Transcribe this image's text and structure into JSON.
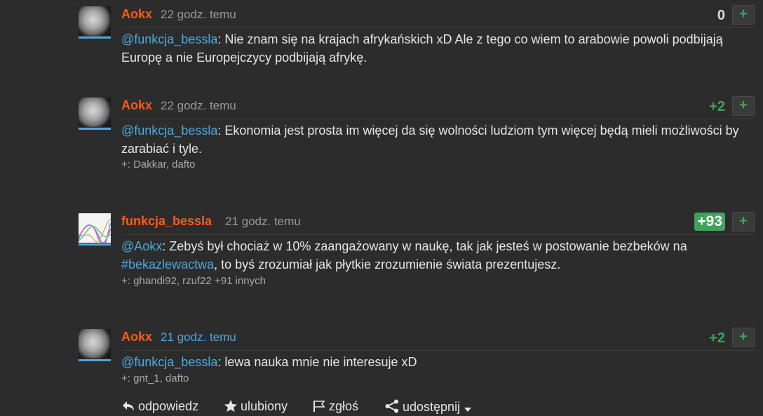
{
  "comments": [
    {
      "author": "Aokx",
      "time": "22 godz. temu",
      "score": "0",
      "plus": "+",
      "mention": "@funkcja_bessla",
      "text": ": Nie znam się na krajach afrykańskich xD Ale z tego co wiem to arabowie powoli podbijają Europę a nie Europejczycy podbijają afrykę."
    },
    {
      "author": "Aokx",
      "time": "22 godz. temu",
      "score": "+2",
      "plus": "+",
      "mention": "@funkcja_bessla",
      "text": ": Ekonomia jest prosta im więcej da się wolności ludziom tym więcej będą mieli możliwości by zarabiać i tyle.",
      "votes": "+: Dakkar, dafto"
    },
    {
      "author": "funkcja_bessla",
      "time": "21 godz. temu",
      "score": "+93",
      "plus": "+",
      "mention": "@Aokx",
      "text_a": ": Zebyś był chociaż w 10% zaangażowany w naukę, tak jak jesteś w postowanie bezbeków na ",
      "hashtag": "#bekazlewactwa",
      "text_b": ", to byś zrozumiał jak płytkie zrozumienie świata prezentujesz.",
      "votes": "+: ghandi92, rzuf22 +91 innych"
    },
    {
      "author": "Aokx",
      "time": "21 godz. temu",
      "score": "+2",
      "plus": "+",
      "mention": "@funkcja_bessla",
      "text": ": lewa nauka mnie nie interesuje xD",
      "votes": "+: gnt_1, dafto"
    }
  ],
  "actions": {
    "reply": "odpowiedz",
    "favorite": "ulubiony",
    "report": "zgłoś",
    "share": "udostępnij"
  },
  "colors": {
    "background": "#2c2c2c",
    "author": "#ff5917",
    "link": "#4ea8de",
    "positive": "#3fa35b"
  },
  "icons": [
    "reply-icon",
    "star-icon",
    "flag-icon",
    "share-icon",
    "caret-down-icon",
    "plus-icon"
  ]
}
